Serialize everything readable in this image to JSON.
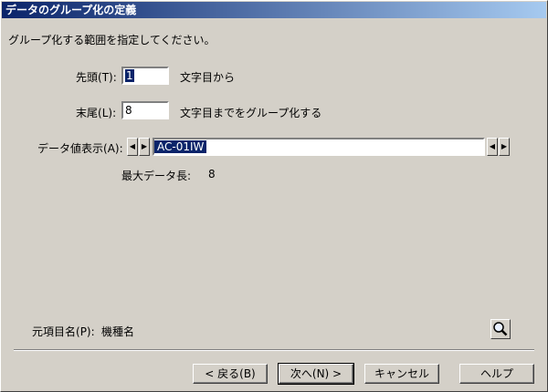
{
  "window": {
    "title": "データのグループ化の定義"
  },
  "instruction": "グループ化する範囲を指定してください。",
  "start": {
    "label": "先頭",
    "key": "(T):",
    "value": "1",
    "suffix": "文字目から"
  },
  "end": {
    "label": "末尾",
    "key": "(L):",
    "value": "8",
    "suffix": "文字目までをグループ化する"
  },
  "data_display": {
    "label": "データ値表示",
    "key": "(A):",
    "value": "AC-01IW"
  },
  "max_length": {
    "label": "最大データ長:",
    "value": "8"
  },
  "source_item": {
    "label": "元項目名",
    "key": "(P):",
    "value": "機種名"
  },
  "buttons": {
    "back": "< 戻る(B)",
    "next": "次へ(N) >",
    "cancel": "キャンセル",
    "help": "ヘルプ"
  },
  "icons": {
    "search": "magnifier-icon"
  }
}
